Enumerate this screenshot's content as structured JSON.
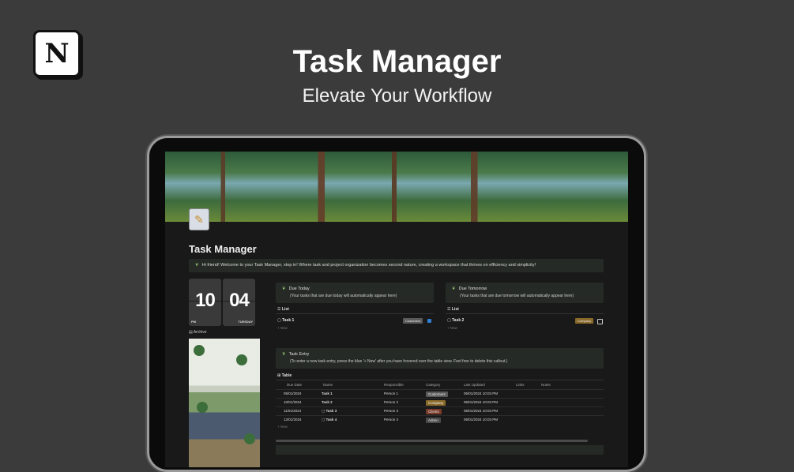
{
  "brand": {
    "logo_letter": "N"
  },
  "hero": {
    "title": "Task Manager",
    "subtitle": "Elevate Your Workflow"
  },
  "page": {
    "icon": "pencil-memo-icon",
    "title": "Task Manager",
    "welcome": "Hi friend! Welcome to your Task Manager, step in! Where task and project organization becomes second nature, creating a workspace that thrives on efficiency and simplicity!"
  },
  "clock": {
    "hour": "10",
    "minute": "04",
    "ampm": "PM",
    "day": "TUESDAY"
  },
  "archive_label": "Archive",
  "due_today": {
    "title": "Due Today",
    "hint": "(Your tasks that are due today will automatically appear here)",
    "view": "List",
    "task": "Task 1",
    "tag": "Customers",
    "tag_color": "#5a5a5a",
    "checked": true,
    "new_label": "+ New"
  },
  "due_tomorrow": {
    "title": "Due Tomorrow",
    "hint": "(Your tasks that are due tomorrow will automatically appear here)",
    "view": "List",
    "task": "Task 2",
    "tag": "Company",
    "tag_color": "#8a6a2a",
    "checked": false,
    "new_label": "+ New"
  },
  "task_entry": {
    "title": "Task Entry",
    "hint": "(To enter a new task entry, press the blue '+ New' after you have hovered over the table view. Feel free to delete this callout.)",
    "view": "Table",
    "columns": [
      "Due Date",
      "Name",
      "Responsible",
      "Category",
      "Last Updated",
      "Links",
      "Notes"
    ],
    "rows": [
      {
        "due": "05/01/2024",
        "name": "Task 1",
        "responsible": "Person 1",
        "category": "Customers",
        "cat_color": "#5a5a5a",
        "updated": "05/01/2024 10:03 PM"
      },
      {
        "due": "10/01/2024",
        "name": "Task 2",
        "responsible": "Person 2",
        "category": "Company",
        "cat_color": "#8a6a2a",
        "updated": "05/01/2024 10:03 PM"
      },
      {
        "due": "11/01/2024",
        "name": "Task 3",
        "responsible": "Person 3",
        "category": "Clients",
        "cat_color": "#7a3a2a",
        "updated": "05/01/2024 10:03 PM"
      },
      {
        "due": "12/01/2024",
        "name": "Task 4",
        "responsible": "Person 4",
        "category": "Admin",
        "cat_color": "#4a4a4a",
        "updated": "05/01/2024 10:03 PM"
      }
    ],
    "new_label": "+ New"
  },
  "colors": {
    "background": "#3b3b3b",
    "screen": "#191919",
    "callout": "#252a26",
    "checkbox_blue": "#2f7fd8"
  }
}
